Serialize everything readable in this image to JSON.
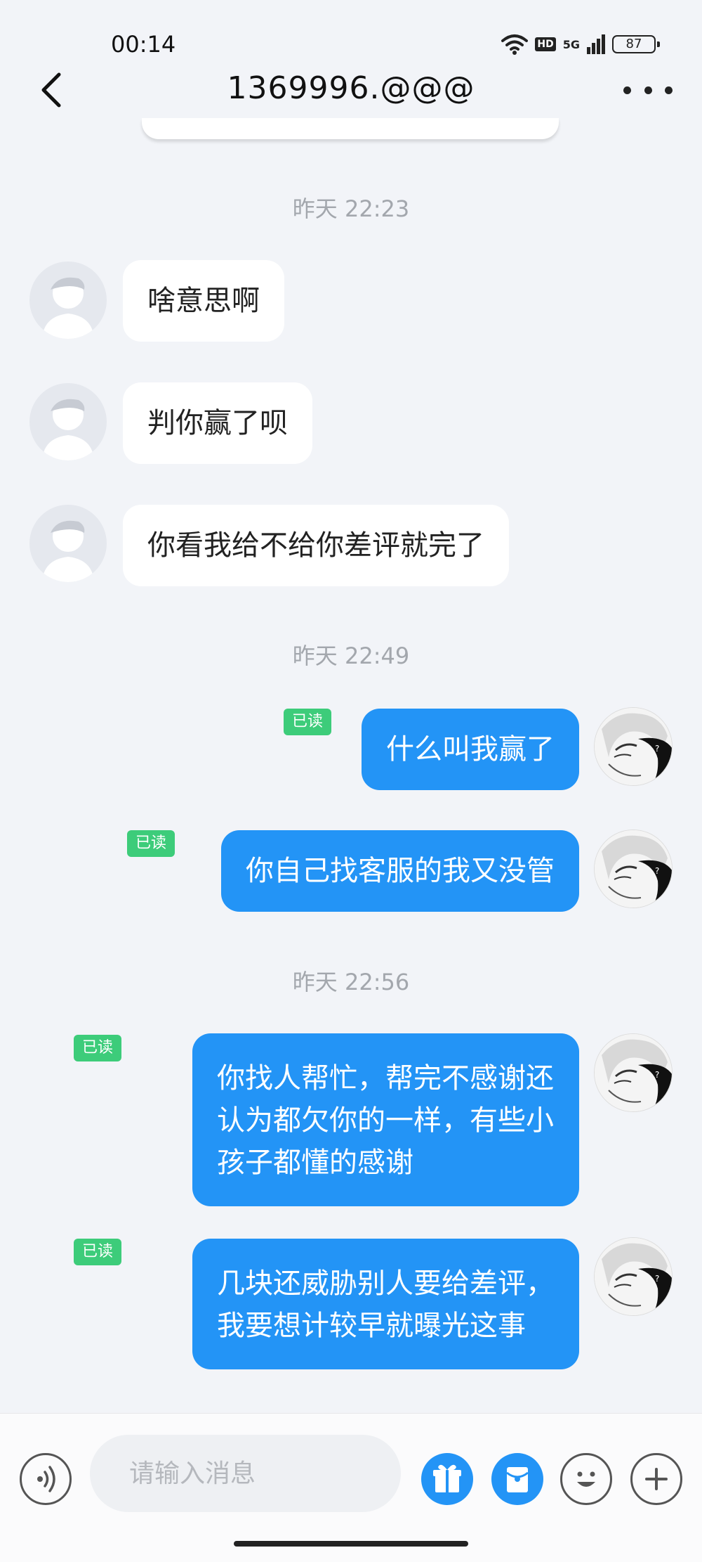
{
  "status_bar": {
    "time": "00:14",
    "battery": "87",
    "hd": "HD",
    "network": "5G"
  },
  "header": {
    "title": "1369996.@@@"
  },
  "timestamps": [
    "昨天 22:23",
    "昨天 22:49",
    "昨天 22:56"
  ],
  "incoming": [
    {
      "text": "啥意思啊"
    },
    {
      "text": "判你赢了呗"
    },
    {
      "text": "你看我给不给你差评就完了"
    }
  ],
  "outgoing": [
    {
      "lines": [
        "什么叫我赢了"
      ],
      "status": "已读"
    },
    {
      "lines": [
        "你自己找客服的我又没管"
      ],
      "status": "已读"
    },
    {
      "lines": [
        "你找人帮忙，帮完不感谢还",
        "认为都欠你的一样，有些小",
        "孩子都懂的感谢"
      ],
      "status": "已读"
    },
    {
      "lines": [
        "几块还威胁别人要给差评，",
        "我要想计较早就曝光这事"
      ],
      "status": "已读"
    }
  ],
  "composer": {
    "placeholder": "请输入消息"
  },
  "icons": {
    "back": "chevron-left-icon",
    "more": "more-dots-icon",
    "voice": "voice-icon",
    "gift": "gift-icon",
    "red_packet": "red-packet-icon",
    "emoji": "emoji-icon",
    "add": "plus-icon"
  },
  "colors": {
    "bubble_out": "#2394f6",
    "read_badge": "#3dcc7a",
    "background": "#f2f4f8"
  }
}
